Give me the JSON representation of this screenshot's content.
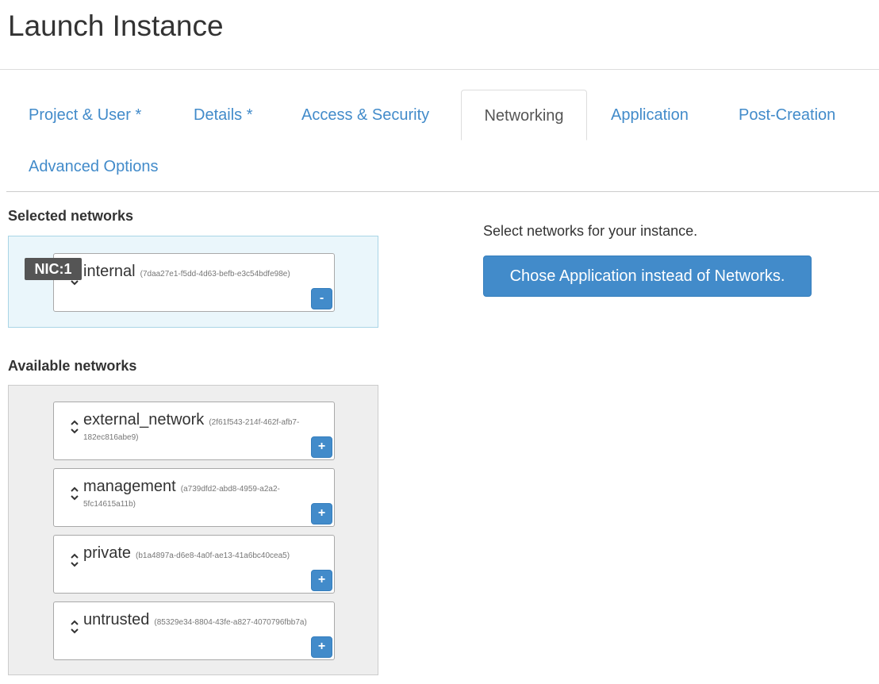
{
  "page": {
    "title": "Launch Instance"
  },
  "tabs": [
    {
      "label": "Project & User *",
      "active": false
    },
    {
      "label": "Details *",
      "active": false
    },
    {
      "label": "Access & Security",
      "active": false
    },
    {
      "label": "Networking",
      "active": true
    },
    {
      "label": "Application",
      "active": false
    },
    {
      "label": "Post-Creation",
      "active": false
    },
    {
      "label": "Advanced Options",
      "active": false
    }
  ],
  "selected_networks": {
    "heading": "Selected networks",
    "items": [
      {
        "badge": "NIC:1",
        "name": "internal",
        "id": "(7daa27e1-f5dd-4d63-befb-e3c54bdfe98e)",
        "button": "-"
      }
    ]
  },
  "available_networks": {
    "heading": "Available networks",
    "items": [
      {
        "name": "external_network",
        "id_part1": "(2f61f543-214f-462f-afb7-",
        "id_part2": "182ec816abe9)",
        "button": "+"
      },
      {
        "name": "management",
        "id_part1": "(a739dfd2-abd8-4959-a2a2-",
        "id_part2": "5fc14615a11b)",
        "button": "+"
      },
      {
        "name": "private",
        "id_part1": "(b1a4897a-d6e8-4a0f-ae13-41a6bc40cea5)",
        "id_part2": "",
        "button": "+"
      },
      {
        "name": "untrusted",
        "id_part1": "(85329e34-8804-43fe-a827-4070796fbb7a)",
        "id_part2": "",
        "button": "+"
      }
    ]
  },
  "help": {
    "text": "Select networks for your instance.",
    "button_label": "Chose Application instead of Networks."
  },
  "colors": {
    "accent": "#428bca",
    "selected_bg": "#eaf6fb",
    "available_bg": "#eeeeee",
    "badge_bg": "#555555"
  },
  "icons": {
    "sort": "sort-arrows-icon"
  }
}
